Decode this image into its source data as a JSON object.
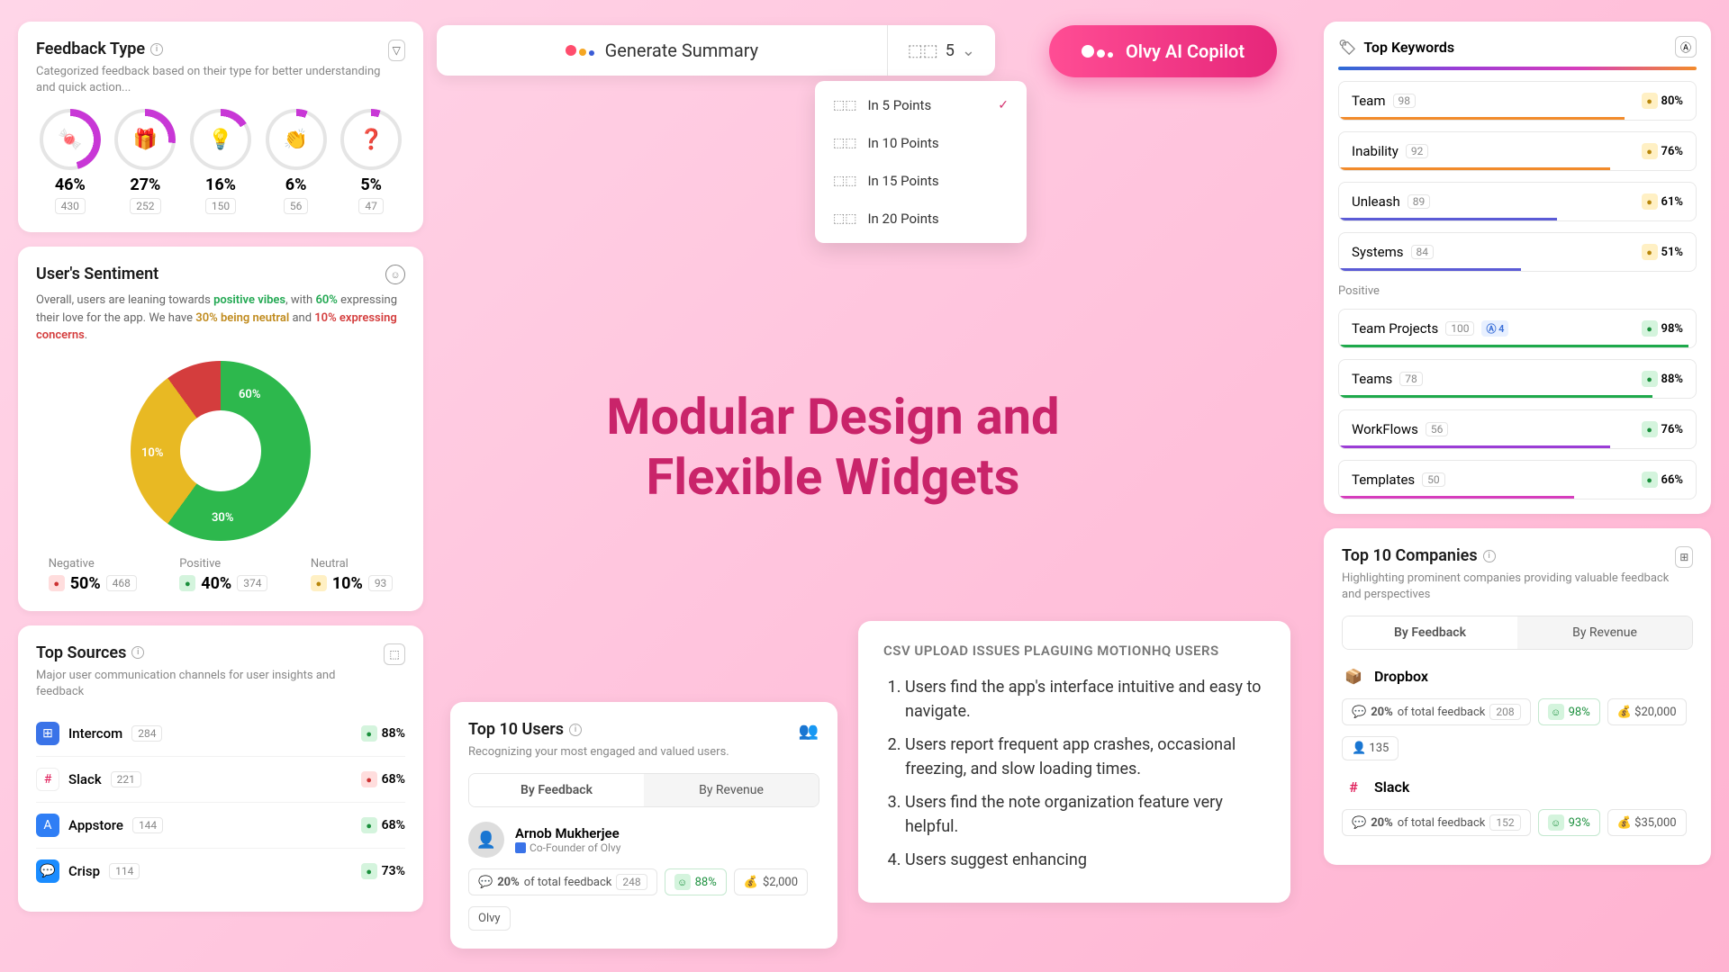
{
  "feedbackType": {
    "title": "Feedback Type",
    "subtitle": "Categorized feedback based on their type for better understanding and quick action...",
    "items": [
      {
        "emoji": "🍬",
        "pct": "46%",
        "count": "430",
        "color": "#c837d6",
        "deg": 165
      },
      {
        "emoji": "🎁",
        "pct": "27%",
        "count": "252",
        "color": "#c837d6",
        "deg": 97
      },
      {
        "emoji": "💡",
        "pct": "16%",
        "count": "150",
        "color": "#c837d6",
        "deg": 58
      },
      {
        "emoji": "👏",
        "pct": "6%",
        "count": "56",
        "color": "#c837d6",
        "deg": 22
      },
      {
        "emoji": "❓",
        "pct": "5%",
        "count": "47",
        "color": "#c837d6",
        "deg": 18
      }
    ]
  },
  "sentiment": {
    "title": "User's Sentiment",
    "textParts": [
      "Overall, users are leaning towards ",
      "positive vibes",
      ", with ",
      "60%",
      " expressing their love for the app. We have ",
      "30% being neutral",
      " and ",
      "10% expressing concerns",
      "."
    ],
    "donut": {
      "pos": "60%",
      "neu": "30%",
      "neg": "10%"
    },
    "stats": [
      {
        "label": "Negative",
        "icon": "sq-red",
        "pct": "50%",
        "count": "468"
      },
      {
        "label": "Positive",
        "icon": "sq-green",
        "pct": "40%",
        "count": "374"
      },
      {
        "label": "Neutral",
        "icon": "sq-yellow",
        "pct": "10%",
        "count": "93"
      }
    ]
  },
  "topSources": {
    "title": "Top Sources",
    "subtitle": "Major user communication channels for user insights and feedback",
    "items": [
      {
        "name": "Intercom",
        "count": "284",
        "pct": "88%",
        "iconColor": "#3a73e8",
        "sentiment": "green"
      },
      {
        "name": "Slack",
        "count": "221",
        "pct": "68%",
        "iconColor": "#fff",
        "sentiment": "red"
      },
      {
        "name": "Appstore",
        "count": "144",
        "pct": "68%",
        "iconColor": "#2f7ef5",
        "sentiment": "green"
      },
      {
        "name": "Crisp",
        "count": "114",
        "pct": "73%",
        "iconColor": "#1a8cff",
        "sentiment": "green"
      }
    ]
  },
  "genSummary": {
    "label": "Generate Summary",
    "count": "5"
  },
  "dropdown": {
    "items": [
      {
        "label": "In 5 Points",
        "selected": true
      },
      {
        "label": "In 10 Points",
        "selected": false
      },
      {
        "label": "In 15 Points",
        "selected": false
      },
      {
        "label": "In 20 Points",
        "selected": false
      }
    ]
  },
  "copilot": {
    "label": "Olvy AI Copilot"
  },
  "hero": {
    "line1": "Modular Design and",
    "line2": "Flexible Widgets"
  },
  "summary": {
    "heading": "CSV UPLOAD ISSUES PLAGUING MOTIONHQ USERS",
    "points": [
      "Users find the app's interface intuitive and easy to navigate.",
      "Users report frequent app crashes, occasional freezing, and slow loading times.",
      "Users find the note organization feature very helpful.",
      "Users suggest enhancing"
    ]
  },
  "topUsers": {
    "title": "Top 10 Users",
    "subtitle": "Recognizing your most engaged and valued users.",
    "tabs": [
      "By Feedback",
      "By Revenue"
    ],
    "activeTab": 0,
    "user": {
      "name": "Arnob Mukherjee",
      "role": "Co-Founder of Olvy"
    },
    "chips": {
      "feedbackPct": "20%",
      "feedbackLabel": "of total feedback",
      "feedbackCount": "248",
      "sentiment": "88%",
      "revenue": "$2,000",
      "tag": "Olvy"
    }
  },
  "topKeywords": {
    "title": "Top Keywords",
    "neutral": [
      {
        "name": "Team",
        "count": "98",
        "pct": "80%",
        "color": "#f28b2b"
      },
      {
        "name": "Inability",
        "count": "92",
        "pct": "76%",
        "color": "#f28b2b"
      },
      {
        "name": "Unleash",
        "count": "89",
        "pct": "61%",
        "color": "#5b5bd6"
      },
      {
        "name": "Systems",
        "count": "84",
        "pct": "51%",
        "color": "#5b5bd6"
      }
    ],
    "posLabel": "Positive",
    "positive": [
      {
        "name": "Team Projects",
        "count": "100",
        "pct": "98%",
        "color": "#1ea94b",
        "badge": "4"
      },
      {
        "name": "Teams",
        "count": "78",
        "pct": "88%",
        "color": "#1ea94b"
      },
      {
        "name": "WorkFlows",
        "count": "56",
        "pct": "76%",
        "color": "#9b3dd6"
      },
      {
        "name": "Templates",
        "count": "50",
        "pct": "66%",
        "color": "#d63dbd"
      }
    ]
  },
  "topCompanies": {
    "title": "Top 10 Companies",
    "subtitle": "Highlighting prominent companies providing valuable feedback and perspectives",
    "tabs": [
      "By Feedback",
      "By Revenue"
    ],
    "activeTab": 0,
    "items": [
      {
        "name": "Dropbox",
        "icon": "📦",
        "iconColor": "#0b63d1",
        "feedbackPct": "20%",
        "feedbackLabel": "of total feedback",
        "count": "208",
        "sentiment": "98%",
        "revenue": "$20,000",
        "users": "135"
      },
      {
        "name": "Slack",
        "icon": "#",
        "feedbackPct": "20%",
        "feedbackLabel": "of total feedback",
        "count": "152",
        "sentiment": "93%",
        "revenue": "$35,000"
      }
    ]
  }
}
